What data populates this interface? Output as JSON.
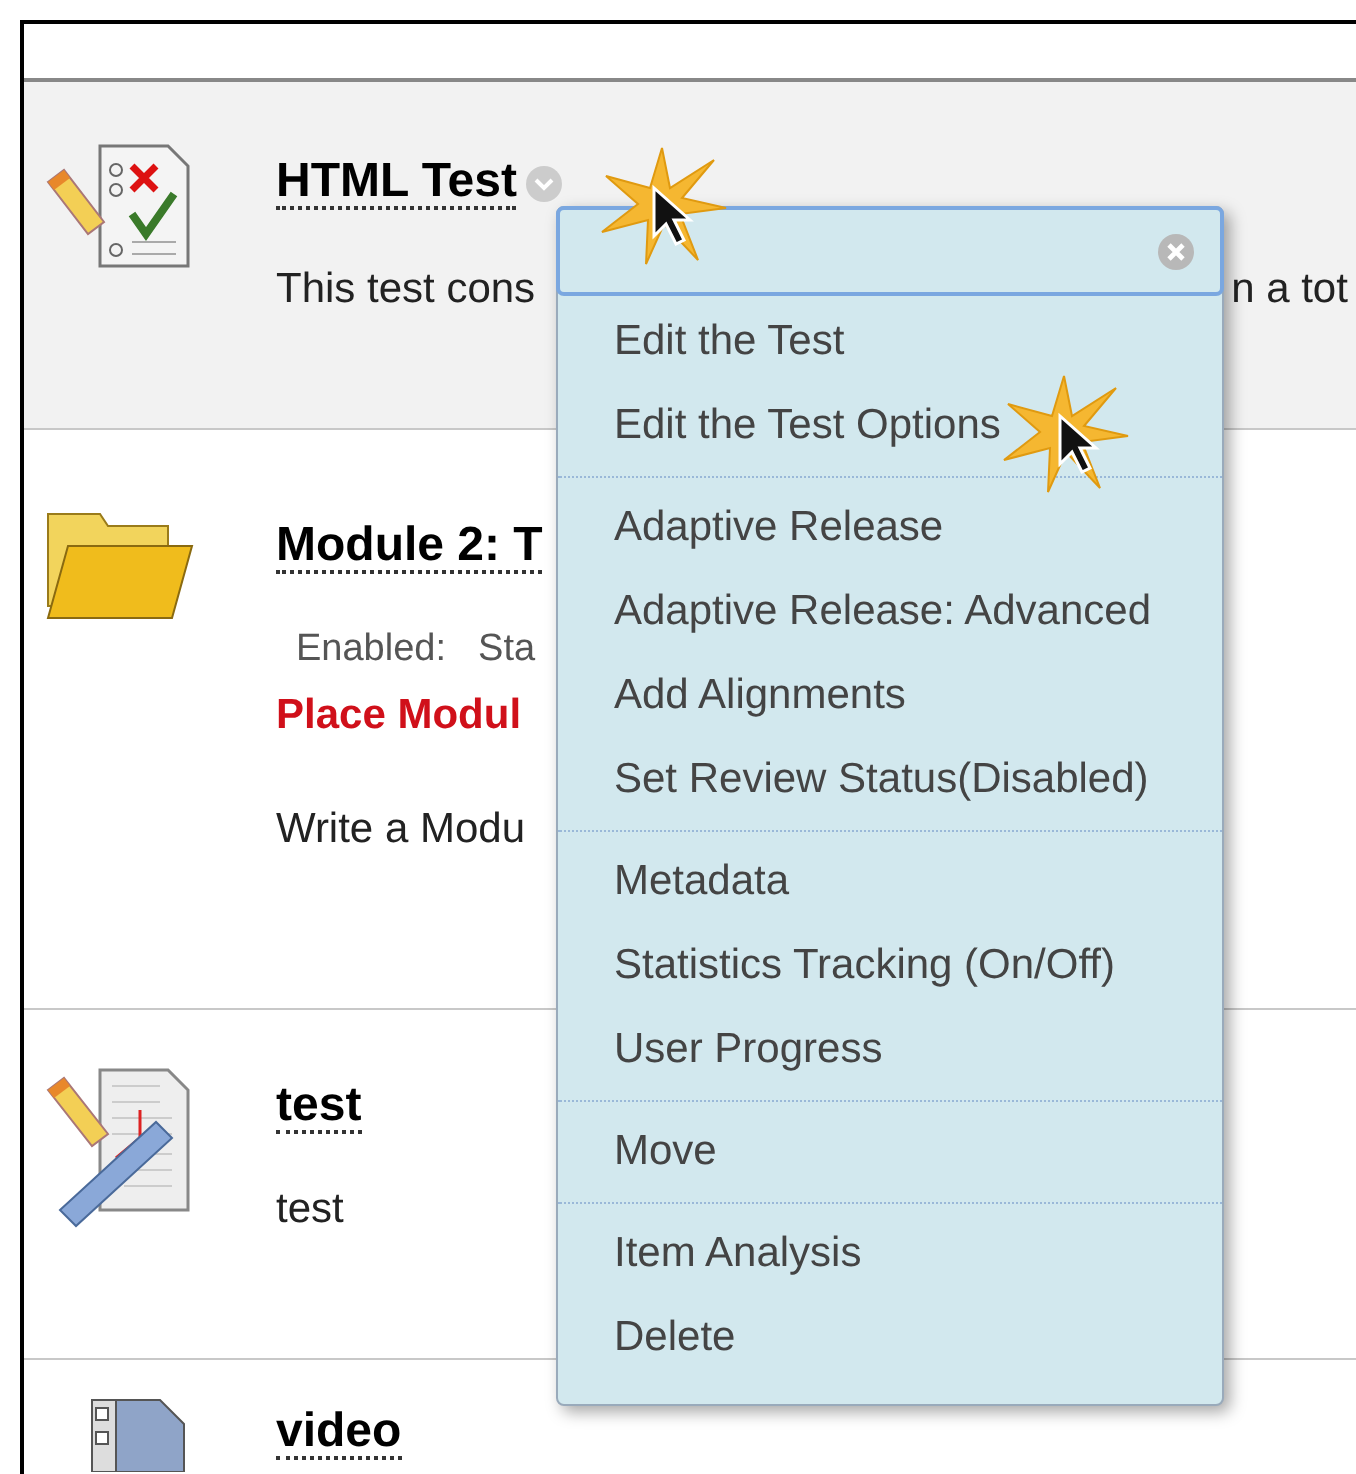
{
  "rows": [
    {
      "kind": "test",
      "selected": true,
      "title": "HTML Test",
      "has_menu": true,
      "lines": [
        {
          "kind": "split",
          "parts": [
            "This test cons",
            "n a tot"
          ]
        }
      ]
    },
    {
      "kind": "folder",
      "selected": false,
      "title": "Module 2: T",
      "lines": [
        {
          "kind": "status",
          "label": "Enabled:",
          "value": "Sta"
        },
        {
          "kind": "alert",
          "text": "Place Modul"
        },
        {
          "kind": "text",
          "text": "Write a Modu"
        }
      ]
    },
    {
      "kind": "survey",
      "selected": false,
      "title": "test",
      "lines": [
        {
          "kind": "text",
          "text": "test"
        }
      ]
    },
    {
      "kind": "video",
      "selected": false,
      "title": "video",
      "lines": []
    }
  ],
  "context_menu": {
    "groups": [
      [
        "Edit the Test",
        "Edit the Test Options"
      ],
      [
        "Adaptive Release",
        "Adaptive Release: Advanced",
        "Add Alignments",
        "Set Review Status(Disabled)"
      ],
      [
        "Metadata",
        "Statistics Tracking (On/Off)",
        "User Progress"
      ],
      [
        "Move"
      ],
      [
        "Item Analysis",
        "Delete"
      ]
    ]
  }
}
